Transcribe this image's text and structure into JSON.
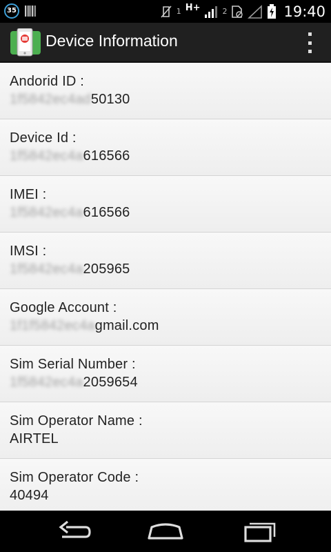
{
  "status_bar": {
    "notification_count": "35",
    "sim1_label": "1",
    "network_type": "H+",
    "sim2_label": "2",
    "time": "19:40"
  },
  "action_bar": {
    "title": "Device Information",
    "app_icon": "device-info-app-icon",
    "overflow_icon": "overflow-menu-icon"
  },
  "items": [
    {
      "label": "Andorid ID :",
      "value_hidden": "1f5842ec4ad",
      "value_visible": "50130"
    },
    {
      "label": "Device Id :",
      "value_hidden": "1f5842ec4a",
      "value_visible": "616566"
    },
    {
      "label": "IMEI :",
      "value_hidden": "1f5842ec4a",
      "value_visible": "616566"
    },
    {
      "label": "IMSI :",
      "value_hidden": "1f5842ec4a",
      "value_visible": "205965"
    },
    {
      "label": "Google Account :",
      "value_hidden": "1f1f5842ec4a",
      "value_visible": "gmail.com"
    },
    {
      "label": "Sim Serial Number :",
      "value_hidden": "1f5842ec4a",
      "value_visible": "2059654"
    },
    {
      "label": "Sim Operator Name :",
      "value_hidden": "",
      "value_visible": "AIRTEL"
    },
    {
      "label": "Sim Operator Code :",
      "value_hidden": "",
      "value_visible": "40494"
    }
  ],
  "nav_bar": {
    "back_icon": "back-icon",
    "home_icon": "home-icon",
    "recents_icon": "recents-icon"
  },
  "colors": {
    "status_bar_bg": "#000000",
    "action_bar_bg": "#202020",
    "list_bg": "#f4f4f4",
    "divider": "#d4d4d4",
    "text": "#222222"
  }
}
